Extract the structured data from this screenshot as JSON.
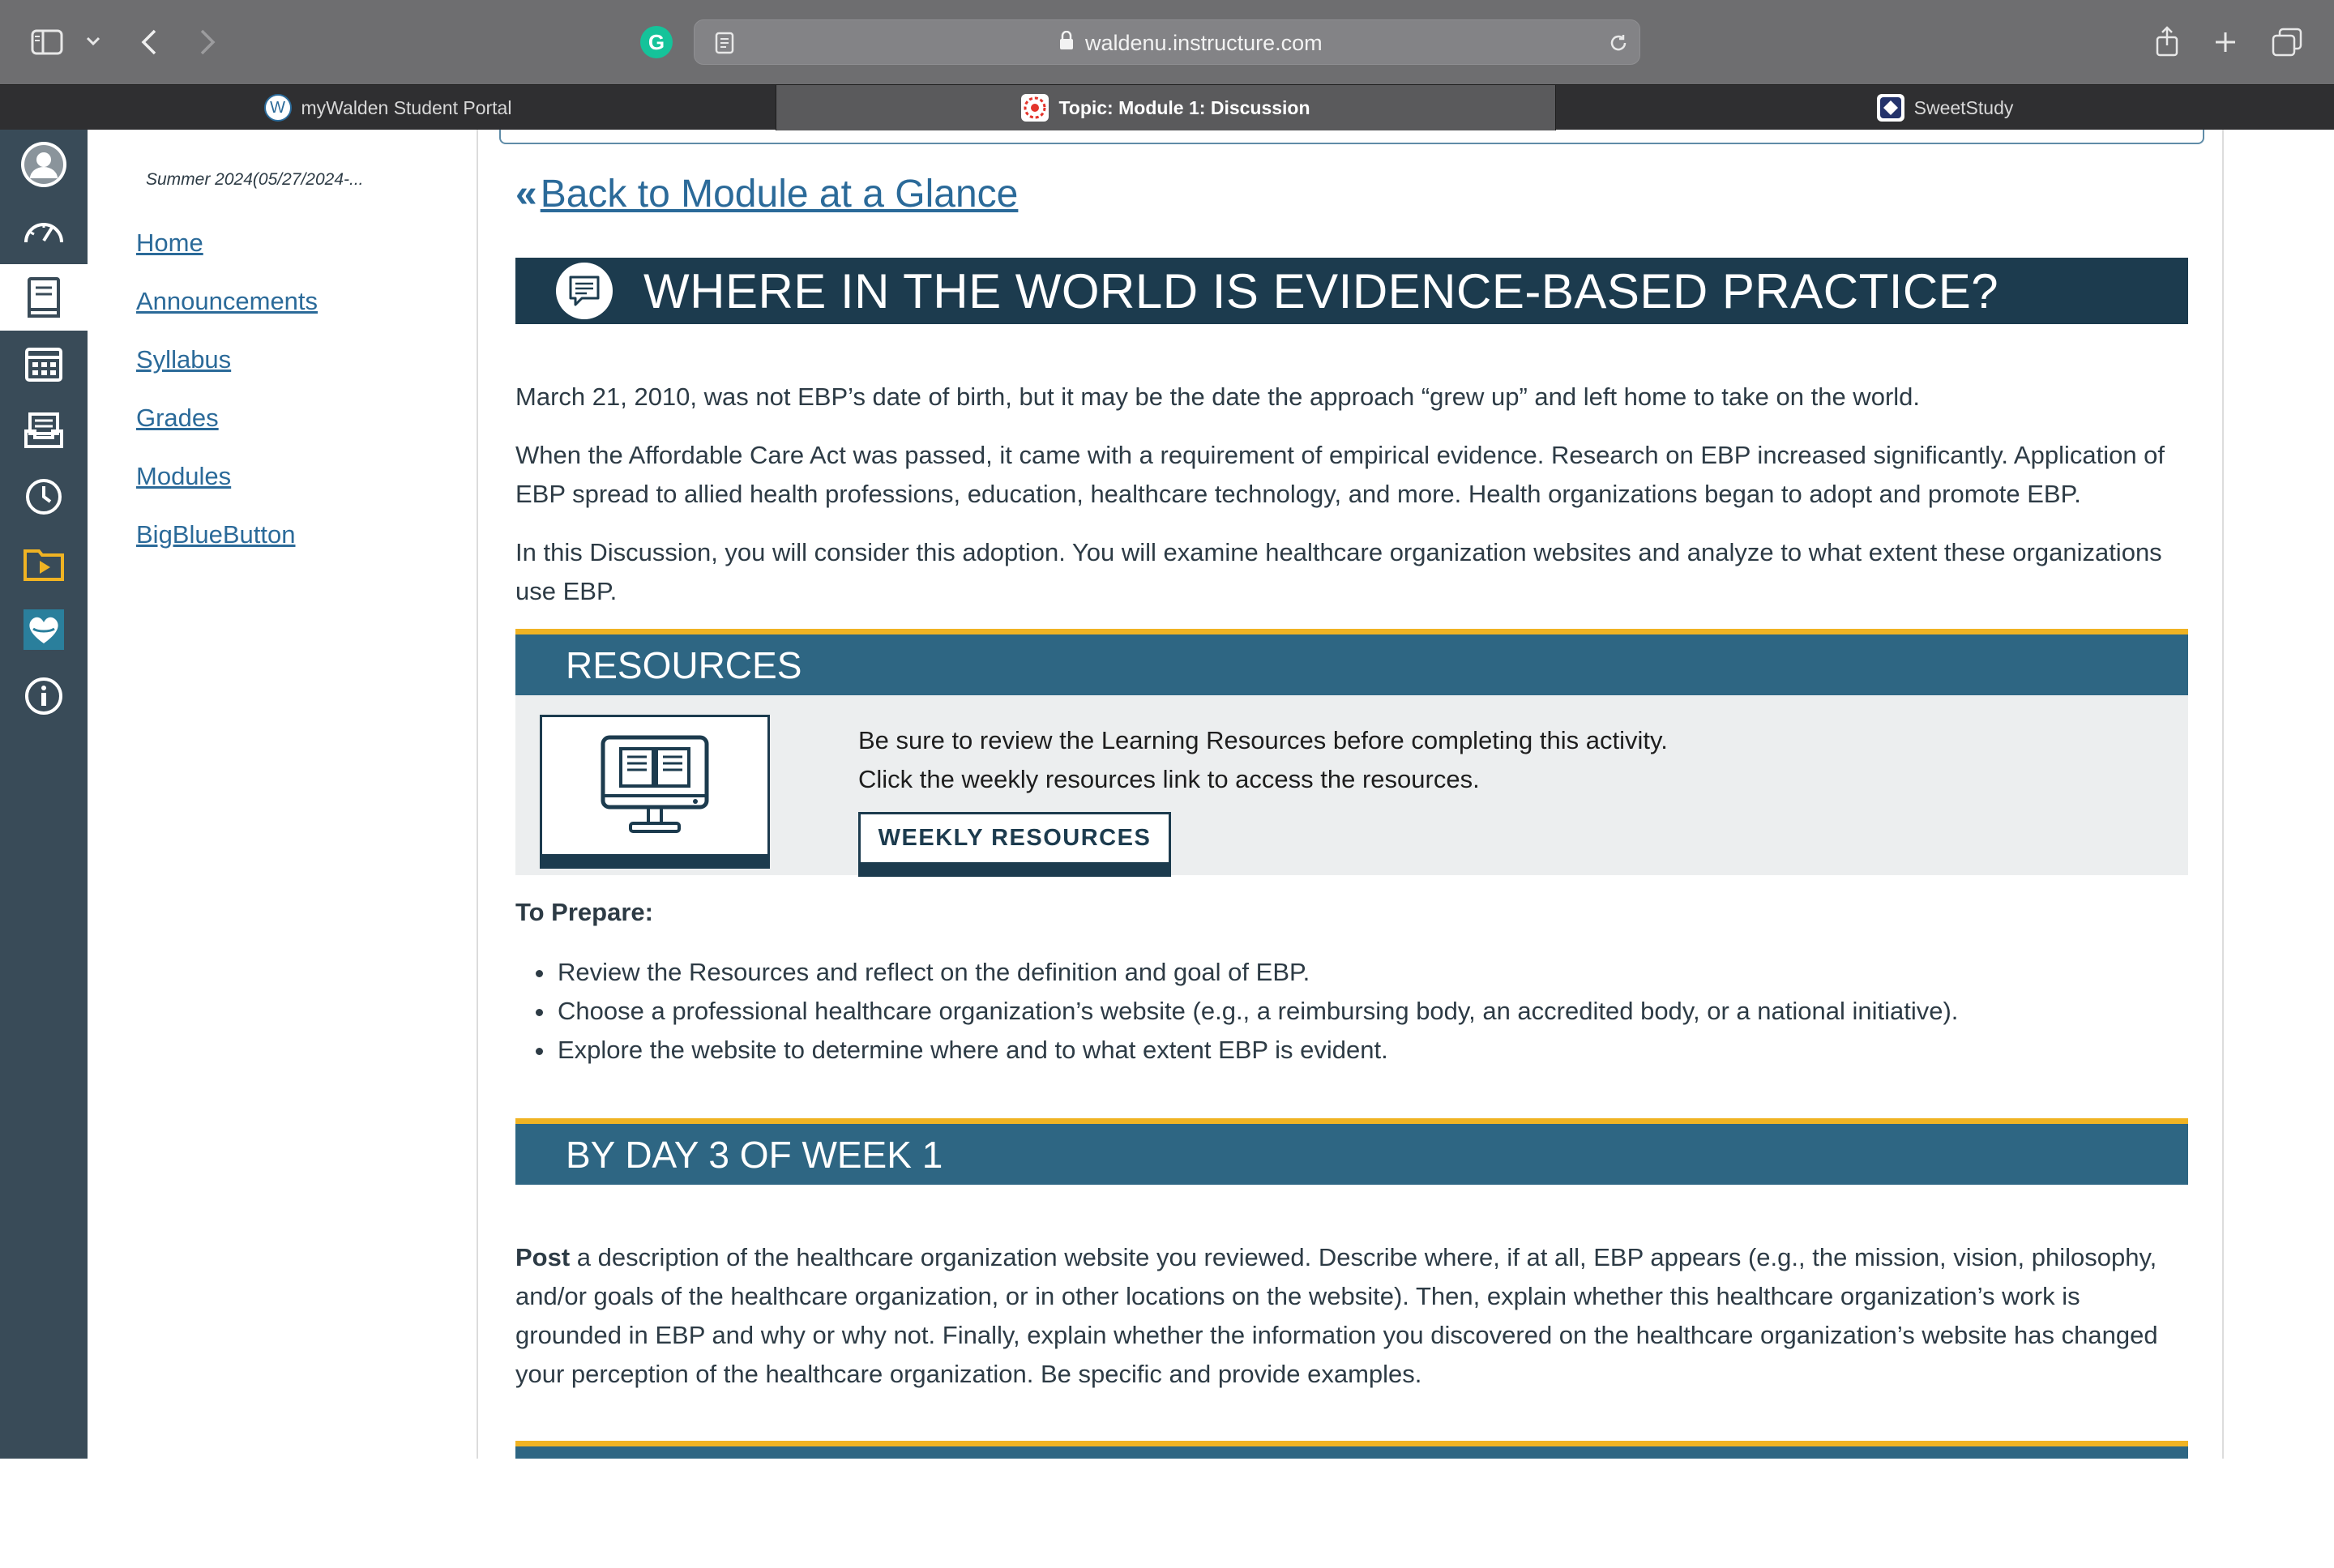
{
  "browser": {
    "url": "waldenu.instructure.com",
    "tabs": [
      {
        "label": "myWalden Student Portal",
        "favicon_letter": "W"
      },
      {
        "label": "Topic: Module 1: Discussion"
      },
      {
        "label": "SweetStudy"
      }
    ],
    "extension_letter": "G"
  },
  "course_nav": {
    "term": "Summer 2024(05/27/2024-...",
    "links": [
      "Home",
      "Announcements",
      "Syllabus",
      "Grades",
      "Modules",
      "BigBlueButton"
    ]
  },
  "page": {
    "back_arrow": "«",
    "back_link": "Back to Module at a Glance",
    "title": "WHERE IN THE WORLD IS EVIDENCE-BASED PRACTICE?",
    "intro_paragraphs": [
      "March 21, 2010, was not EBP’s date of birth, but it may be the date the approach “grew up” and left home to take on the world.",
      "When the Affordable Care Act was passed, it came with a requirement of empirical evidence. Research on EBP increased significantly. Application of EBP spread to allied health professions, education, healthcare technology, and more. Health organizations began to adopt and promote EBP.",
      "In this Discussion, you will consider this adoption. You will examine healthcare organization websites and analyze to what extent these organizations use EBP."
    ],
    "resources": {
      "heading": "RESOURCES",
      "line1": "Be sure to review the Learning Resources before completing this activity.",
      "line2": "Click the weekly resources link to access the resources.",
      "button": "WEEKLY RESOURCES"
    },
    "prepare": {
      "heading": "To Prepare:",
      "items": [
        "Review the Resources and reflect on the definition and goal of EBP.",
        "Choose a professional healthcare organization’s website (e.g., a reimbursing body, an accredited body, or a national initiative).",
        "Explore the website to determine where and to what extent EBP is evident."
      ]
    },
    "day3": {
      "heading": "BY DAY 3 OF WEEK 1",
      "post_bold": "Post",
      "post_text": " a description of the healthcare organization website you reviewed. Describe where, if at all, EBP appears (e.g., the mission, vision, philosophy, and/or goals of the healthcare organization, or in other locations on the website). Then, explain whether this healthcare organization’s work is grounded in EBP and why or why not. Finally, explain whether the information you discovered on the healthcare organization’s website has changed your perception of the healthcare organization. Be specific and provide examples."
    }
  },
  "colors": {
    "global_nav": "#394b58",
    "hero": "#1c3b4e",
    "band": "#2e6683",
    "accent": "#f0b323",
    "link": "#2b6a99"
  }
}
